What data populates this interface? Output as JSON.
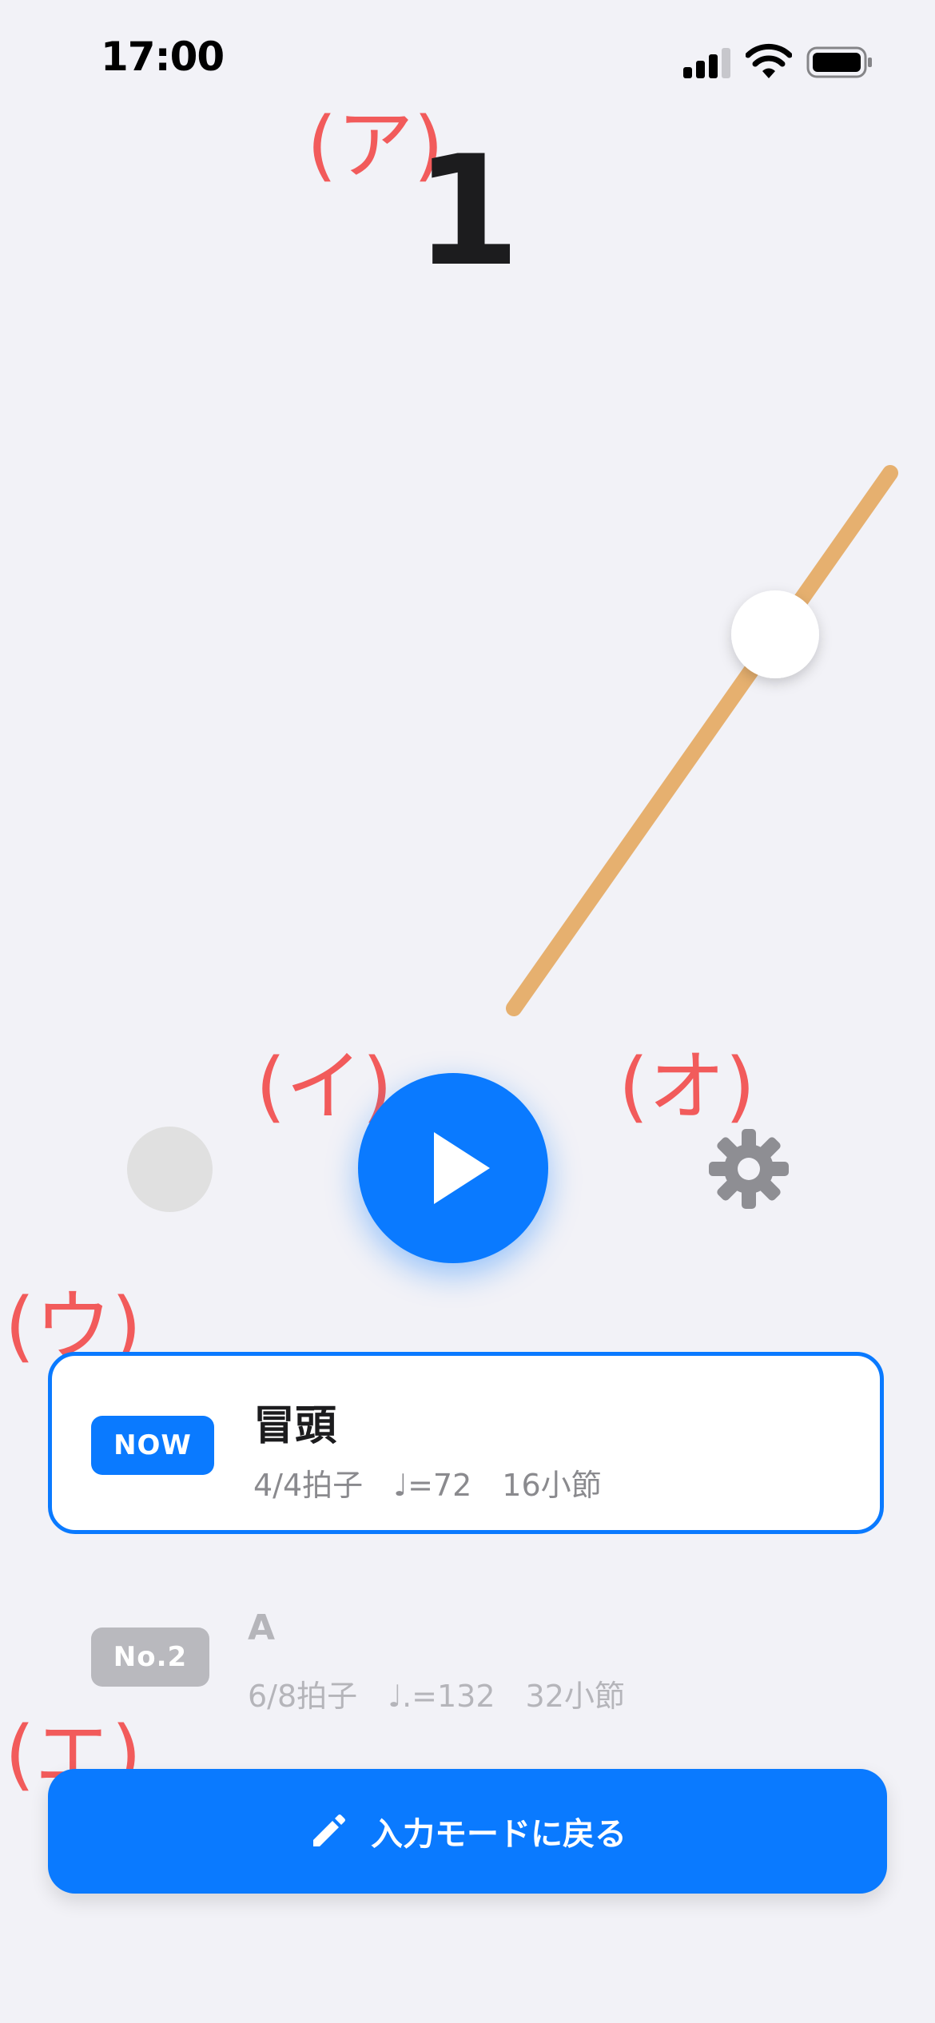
{
  "status_bar": {
    "time": "17:00"
  },
  "metronome": {
    "beat": "1"
  },
  "annotations": {
    "a": "(ア)",
    "i": "(イ)",
    "u": "(ウ)",
    "e": "(エ)",
    "o": "(オ)"
  },
  "icons": {
    "play": "play-icon",
    "settings": "gear-icon",
    "edit": "pencil-icon"
  },
  "sections": [
    {
      "badge": "NOW",
      "title": "冒頭",
      "meta": "4/4拍子　♩=72　16小節",
      "current": true
    },
    {
      "badge": "No.2",
      "title": "A",
      "meta": "6/8拍子　♩.=132　32小節",
      "current": false
    }
  ],
  "return_button": {
    "label": "入力モードに戻る"
  },
  "colors": {
    "accent": "#0a7aff",
    "pendulum": "#e6b06f",
    "marker": "#f25b5b",
    "background": "#f2f2f7"
  }
}
